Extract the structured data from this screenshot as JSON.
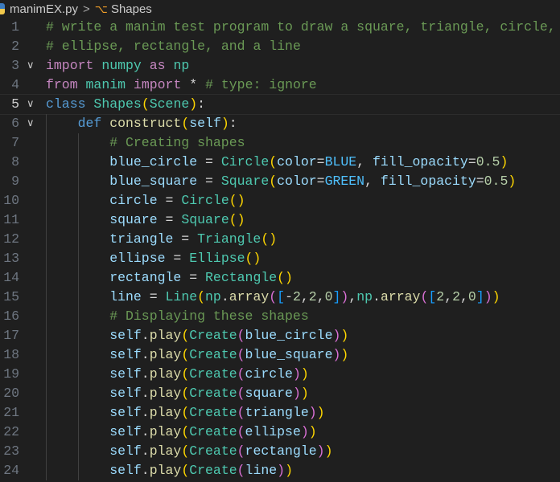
{
  "breadcrumb": {
    "file": "manimEX.py",
    "separator": ">",
    "symbol": "Shapes"
  },
  "current_line": 5,
  "folded_lines": [
    3,
    5,
    6
  ],
  "lines": [
    {
      "indent": 0,
      "tokens": [
        [
          "# write a manim test program to draw a square, triangle, circle,",
          "c"
        ]
      ]
    },
    {
      "indent": 0,
      "tokens": [
        [
          "# ellipse, rectangle, and a line",
          "c"
        ]
      ]
    },
    {
      "indent": 0,
      "tokens": [
        [
          "import",
          "k"
        ],
        [
          " ",
          "o"
        ],
        [
          "numpy",
          "t"
        ],
        [
          " ",
          "o"
        ],
        [
          "as",
          "k"
        ],
        [
          " ",
          "o"
        ],
        [
          "np",
          "t"
        ]
      ]
    },
    {
      "indent": 0,
      "tokens": [
        [
          "from",
          "k"
        ],
        [
          " ",
          "o"
        ],
        [
          "manim",
          "t"
        ],
        [
          " ",
          "o"
        ],
        [
          "import",
          "k"
        ],
        [
          " * ",
          "o"
        ],
        [
          "# type: ignore",
          "c"
        ]
      ]
    },
    {
      "indent": 0,
      "tokens": [
        [
          "class",
          "s"
        ],
        [
          " ",
          "o"
        ],
        [
          "Shapes",
          "t"
        ],
        [
          "(",
          "b1"
        ],
        [
          "Scene",
          "t"
        ],
        [
          ")",
          "b1"
        ],
        [
          ":",
          "o"
        ]
      ]
    },
    {
      "indent": 1,
      "tokens": [
        [
          "def",
          "s"
        ],
        [
          " ",
          "o"
        ],
        [
          "construct",
          "f"
        ],
        [
          "(",
          "b1"
        ],
        [
          "self",
          "v"
        ],
        [
          ")",
          "b1"
        ],
        [
          ":",
          "o"
        ]
      ]
    },
    {
      "indent": 2,
      "tokens": [
        [
          "# Creating shapes",
          "c"
        ]
      ]
    },
    {
      "indent": 2,
      "tokens": [
        [
          "blue_circle",
          "v"
        ],
        [
          " = ",
          "o"
        ],
        [
          "Circle",
          "t"
        ],
        [
          "(",
          "b1"
        ],
        [
          "color",
          "v"
        ],
        [
          "=",
          "o"
        ],
        [
          "BLUE",
          "cst"
        ],
        [
          ", ",
          "o"
        ],
        [
          "fill_opacity",
          "v"
        ],
        [
          "=",
          "o"
        ],
        [
          "0.5",
          "n"
        ],
        [
          ")",
          "b1"
        ]
      ]
    },
    {
      "indent": 2,
      "tokens": [
        [
          "blue_square",
          "v"
        ],
        [
          " = ",
          "o"
        ],
        [
          "Square",
          "t"
        ],
        [
          "(",
          "b1"
        ],
        [
          "color",
          "v"
        ],
        [
          "=",
          "o"
        ],
        [
          "GREEN",
          "cst"
        ],
        [
          ", ",
          "o"
        ],
        [
          "fill_opacity",
          "v"
        ],
        [
          "=",
          "o"
        ],
        [
          "0.5",
          "n"
        ],
        [
          ")",
          "b1"
        ]
      ]
    },
    {
      "indent": 2,
      "tokens": [
        [
          "circle",
          "v"
        ],
        [
          " = ",
          "o"
        ],
        [
          "Circle",
          "t"
        ],
        [
          "()",
          "b1"
        ]
      ]
    },
    {
      "indent": 2,
      "tokens": [
        [
          "square",
          "v"
        ],
        [
          " = ",
          "o"
        ],
        [
          "Square",
          "t"
        ],
        [
          "()",
          "b1"
        ]
      ]
    },
    {
      "indent": 2,
      "tokens": [
        [
          "triangle",
          "v"
        ],
        [
          " = ",
          "o"
        ],
        [
          "Triangle",
          "t"
        ],
        [
          "()",
          "b1"
        ]
      ]
    },
    {
      "indent": 2,
      "tokens": [
        [
          "ellipse",
          "v"
        ],
        [
          " = ",
          "o"
        ],
        [
          "Ellipse",
          "t"
        ],
        [
          "()",
          "b1"
        ]
      ]
    },
    {
      "indent": 2,
      "tokens": [
        [
          "rectangle",
          "v"
        ],
        [
          " = ",
          "o"
        ],
        [
          "Rectangle",
          "t"
        ],
        [
          "()",
          "b1"
        ]
      ]
    },
    {
      "indent": 2,
      "tokens": [
        [
          "line",
          "v"
        ],
        [
          " = ",
          "o"
        ],
        [
          "Line",
          "t"
        ],
        [
          "(",
          "b1"
        ],
        [
          "np",
          "t"
        ],
        [
          ".",
          "o"
        ],
        [
          "array",
          "f"
        ],
        [
          "(",
          "b2"
        ],
        [
          "[",
          "b3"
        ],
        [
          "-",
          "o"
        ],
        [
          "2",
          "n"
        ],
        [
          ",",
          "o"
        ],
        [
          "2",
          "n"
        ],
        [
          ",",
          "o"
        ],
        [
          "0",
          "n"
        ],
        [
          "]",
          "b3"
        ],
        [
          ")",
          "b2"
        ],
        [
          ",",
          "o"
        ],
        [
          "np",
          "t"
        ],
        [
          ".",
          "o"
        ],
        [
          "array",
          "f"
        ],
        [
          "(",
          "b2"
        ],
        [
          "[",
          "b3"
        ],
        [
          "2",
          "n"
        ],
        [
          ",",
          "o"
        ],
        [
          "2",
          "n"
        ],
        [
          ",",
          "o"
        ],
        [
          "0",
          "n"
        ],
        [
          "]",
          "b3"
        ],
        [
          ")",
          "b2"
        ],
        [
          ")",
          "b1"
        ]
      ]
    },
    {
      "indent": 2,
      "tokens": [
        [
          "# Displaying these shapes",
          "c"
        ]
      ]
    },
    {
      "indent": 2,
      "tokens": [
        [
          "self",
          "v"
        ],
        [
          ".",
          "o"
        ],
        [
          "play",
          "f"
        ],
        [
          "(",
          "b1"
        ],
        [
          "Create",
          "t"
        ],
        [
          "(",
          "b2"
        ],
        [
          "blue_circle",
          "v"
        ],
        [
          ")",
          "b2"
        ],
        [
          ")",
          "b1"
        ]
      ]
    },
    {
      "indent": 2,
      "tokens": [
        [
          "self",
          "v"
        ],
        [
          ".",
          "o"
        ],
        [
          "play",
          "f"
        ],
        [
          "(",
          "b1"
        ],
        [
          "Create",
          "t"
        ],
        [
          "(",
          "b2"
        ],
        [
          "blue_square",
          "v"
        ],
        [
          ")",
          "b2"
        ],
        [
          ")",
          "b1"
        ]
      ]
    },
    {
      "indent": 2,
      "tokens": [
        [
          "self",
          "v"
        ],
        [
          ".",
          "o"
        ],
        [
          "play",
          "f"
        ],
        [
          "(",
          "b1"
        ],
        [
          "Create",
          "t"
        ],
        [
          "(",
          "b2"
        ],
        [
          "circle",
          "v"
        ],
        [
          ")",
          "b2"
        ],
        [
          ")",
          "b1"
        ]
      ]
    },
    {
      "indent": 2,
      "tokens": [
        [
          "self",
          "v"
        ],
        [
          ".",
          "o"
        ],
        [
          "play",
          "f"
        ],
        [
          "(",
          "b1"
        ],
        [
          "Create",
          "t"
        ],
        [
          "(",
          "b2"
        ],
        [
          "square",
          "v"
        ],
        [
          ")",
          "b2"
        ],
        [
          ")",
          "b1"
        ]
      ]
    },
    {
      "indent": 2,
      "tokens": [
        [
          "self",
          "v"
        ],
        [
          ".",
          "o"
        ],
        [
          "play",
          "f"
        ],
        [
          "(",
          "b1"
        ],
        [
          "Create",
          "t"
        ],
        [
          "(",
          "b2"
        ],
        [
          "triangle",
          "v"
        ],
        [
          ")",
          "b2"
        ],
        [
          ")",
          "b1"
        ]
      ]
    },
    {
      "indent": 2,
      "tokens": [
        [
          "self",
          "v"
        ],
        [
          ".",
          "o"
        ],
        [
          "play",
          "f"
        ],
        [
          "(",
          "b1"
        ],
        [
          "Create",
          "t"
        ],
        [
          "(",
          "b2"
        ],
        [
          "ellipse",
          "v"
        ],
        [
          ")",
          "b2"
        ],
        [
          ")",
          "b1"
        ]
      ]
    },
    {
      "indent": 2,
      "tokens": [
        [
          "self",
          "v"
        ],
        [
          ".",
          "o"
        ],
        [
          "play",
          "f"
        ],
        [
          "(",
          "b1"
        ],
        [
          "Create",
          "t"
        ],
        [
          "(",
          "b2"
        ],
        [
          "rectangle",
          "v"
        ],
        [
          ")",
          "b2"
        ],
        [
          ")",
          "b1"
        ]
      ]
    },
    {
      "indent": 2,
      "tokens": [
        [
          "self",
          "v"
        ],
        [
          ".",
          "o"
        ],
        [
          "play",
          "f"
        ],
        [
          "(",
          "b1"
        ],
        [
          "Create",
          "t"
        ],
        [
          "(",
          "b2"
        ],
        [
          "line",
          "v"
        ],
        [
          ")",
          "b2"
        ],
        [
          ")",
          "b1"
        ]
      ]
    }
  ]
}
